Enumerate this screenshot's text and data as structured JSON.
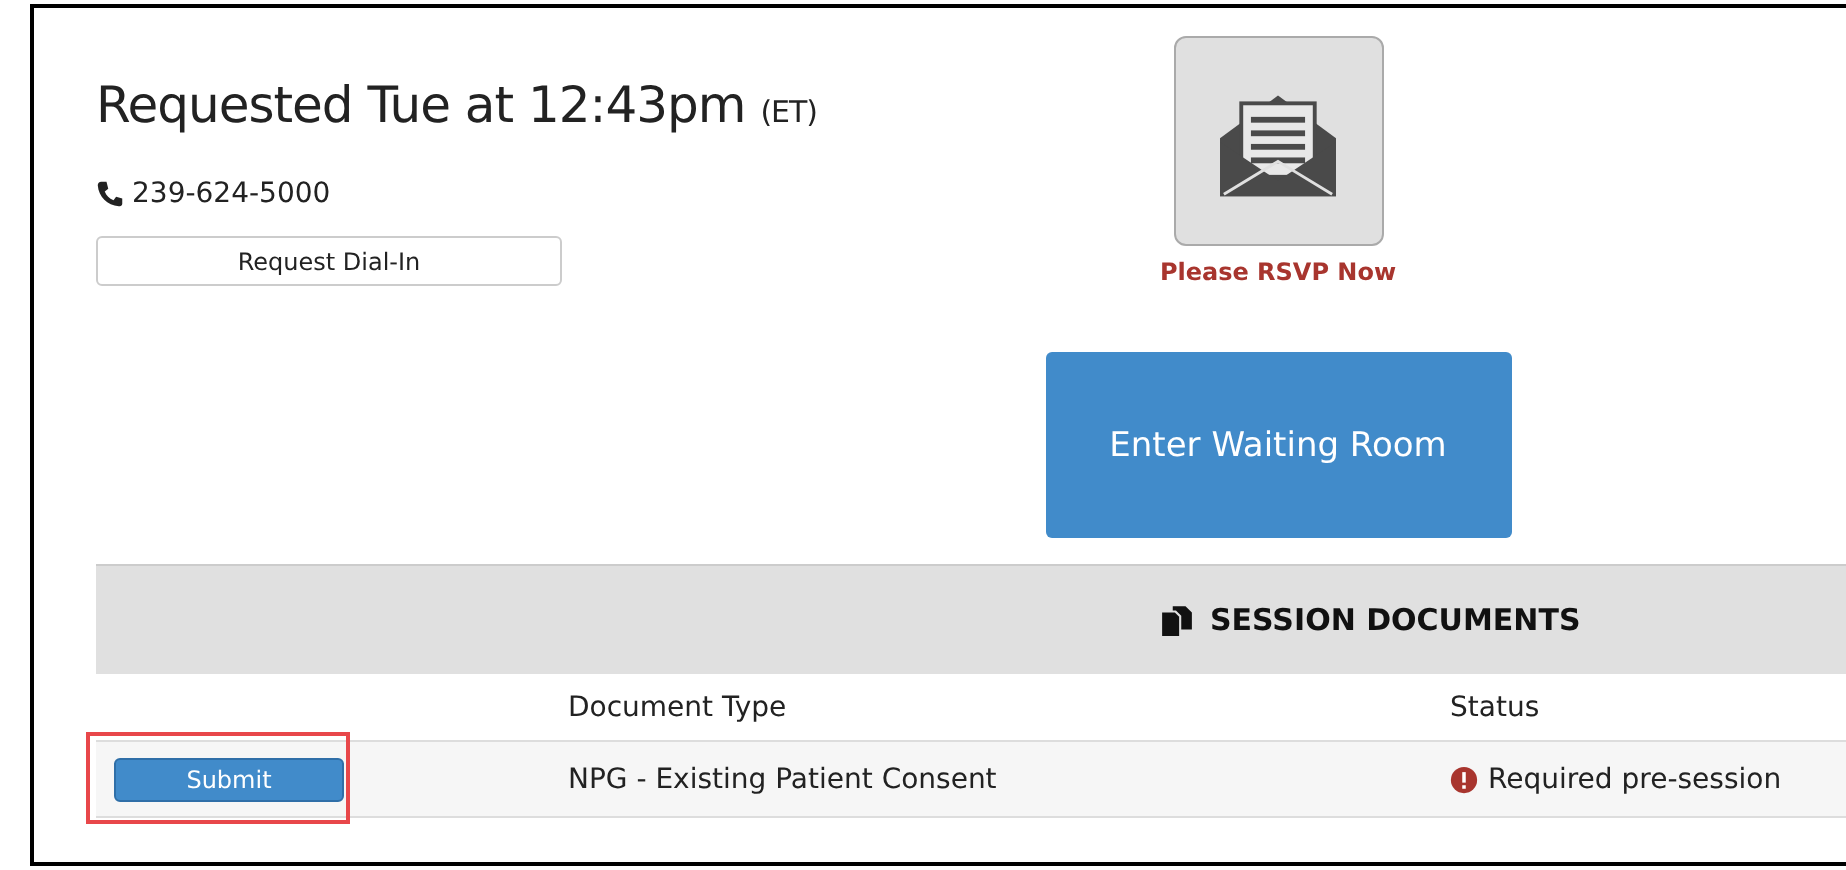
{
  "heading": {
    "title": "Requested Tue at 12:43pm",
    "timezone": "(ET)"
  },
  "phone": "239-624-5000",
  "dial_in_button": "Request Dial-In",
  "rsvp": {
    "label": "Please RSVP Now"
  },
  "waiting_room_button": "Enter Waiting Room",
  "documents": {
    "title": "SESSION DOCUMENTS",
    "columns": [
      "Document Type",
      "Status"
    ],
    "rows": [
      {
        "action": "Submit",
        "highlighted": true,
        "document_type": "NPG - Existing Patient Consent",
        "status": "Required pre-session"
      }
    ]
  }
}
